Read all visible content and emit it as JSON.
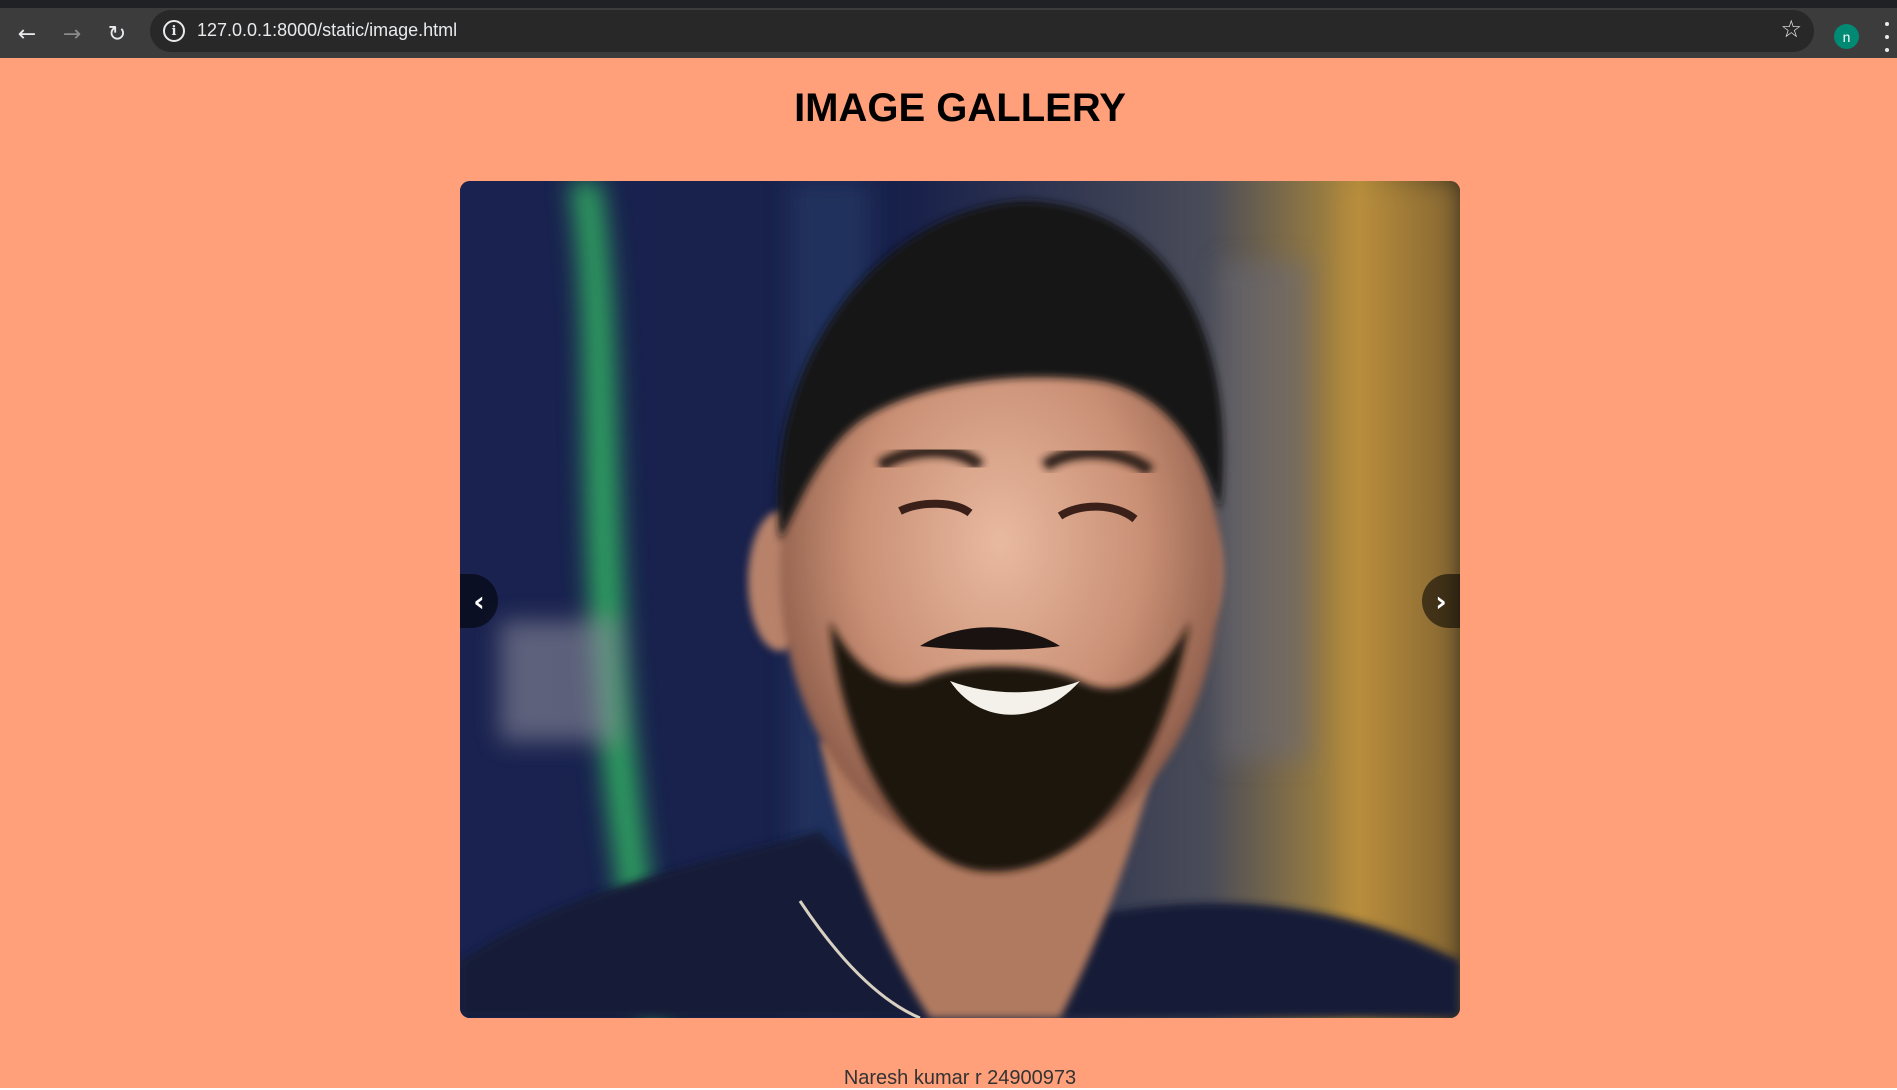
{
  "browser": {
    "url": "127.0.0.1:8000/static/image.html",
    "profile_initial": "n",
    "back_icon": "arrow-left",
    "forward_icon": "arrow-right",
    "reload_icon": "reload",
    "site_info_icon": "info",
    "bookmark_icon": "star-outline",
    "menu_icon": "vertical-dots"
  },
  "page": {
    "title": "IMAGE GALLERY",
    "background_color": "#ffa07a",
    "gallery": {
      "prev_label": "‹",
      "next_label": "›"
    },
    "caption": "Naresh kumar r 24900973"
  }
}
